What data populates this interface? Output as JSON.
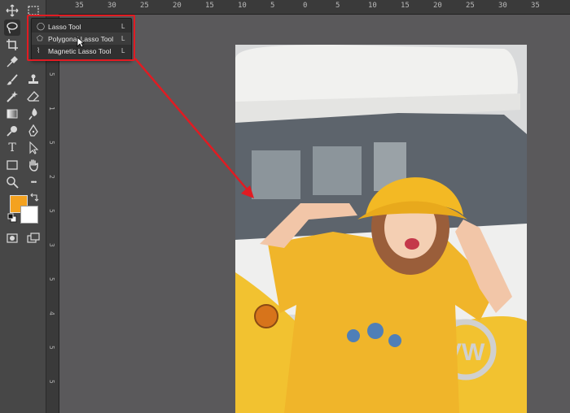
{
  "ruler": {
    "top_labels": [
      "35",
      "30",
      "25",
      "20",
      "15",
      "10",
      "5",
      "0",
      "5",
      "10",
      "15",
      "20",
      "25",
      "30",
      "35"
    ],
    "left_labels": [
      "0",
      "5",
      "1",
      "5",
      "2",
      "5",
      "3",
      "5",
      "4",
      "5",
      "5"
    ]
  },
  "toolbar": {
    "tools": [
      {
        "name": "move-tool",
        "icon": "move-icon"
      },
      {
        "name": "marquee-tool",
        "icon": "marquee-icon"
      },
      {
        "name": "lasso-tool",
        "icon": "lasso-icon"
      },
      {
        "name": "crop-tool",
        "icon": "crop-icon"
      },
      {
        "name": "eyedropper-tool",
        "icon": "eyedropper-icon"
      },
      {
        "name": "brush-tool",
        "icon": "brush-icon"
      },
      {
        "name": "stamp-tool",
        "icon": "stamp-icon"
      },
      {
        "name": "healing-tool",
        "icon": "healing-icon"
      },
      {
        "name": "eraser-tool",
        "icon": "eraser-icon"
      },
      {
        "name": "gradient-tool",
        "icon": "gradient-icon"
      },
      {
        "name": "blur-tool",
        "icon": "blur-icon"
      },
      {
        "name": "dodge-tool",
        "icon": "dodge-icon"
      },
      {
        "name": "pen-tool",
        "icon": "pen-icon"
      },
      {
        "name": "type-tool",
        "icon": "type-icon"
      },
      {
        "name": "path-select-tool",
        "icon": "path-select-icon"
      },
      {
        "name": "shape-tool",
        "icon": "rectangle-icon"
      },
      {
        "name": "hand-tool",
        "icon": "hand-icon"
      },
      {
        "name": "zoom-tool",
        "icon": "zoom-icon"
      },
      {
        "name": "more-tools",
        "icon": "ellipsis-icon"
      },
      {
        "name": "quick-mask",
        "icon": "quick-mask-icon"
      },
      {
        "name": "screen-mode",
        "icon": "screen-mode-icon"
      }
    ],
    "type_glyph": "T",
    "more_glyph": "•••",
    "foreground_color": "#f4a21f",
    "background_color": "#ffffff"
  },
  "flyout": {
    "items": [
      {
        "label": "Lasso Tool",
        "shortcut": "L",
        "icon": "lasso-icon"
      },
      {
        "label": "Polygonal Lasso Tool",
        "shortcut": "L",
        "icon": "polygonal-lasso-icon"
      },
      {
        "label": "Magnetic Lasso Tool",
        "shortcut": "L",
        "icon": "magnetic-lasso-icon"
      }
    ]
  },
  "annotation": {
    "highlight_color": "#e11b22"
  },
  "canvas": {
    "image_description": "photo",
    "shirt_color": "#f0b52a",
    "van_color": "#f2c230"
  }
}
